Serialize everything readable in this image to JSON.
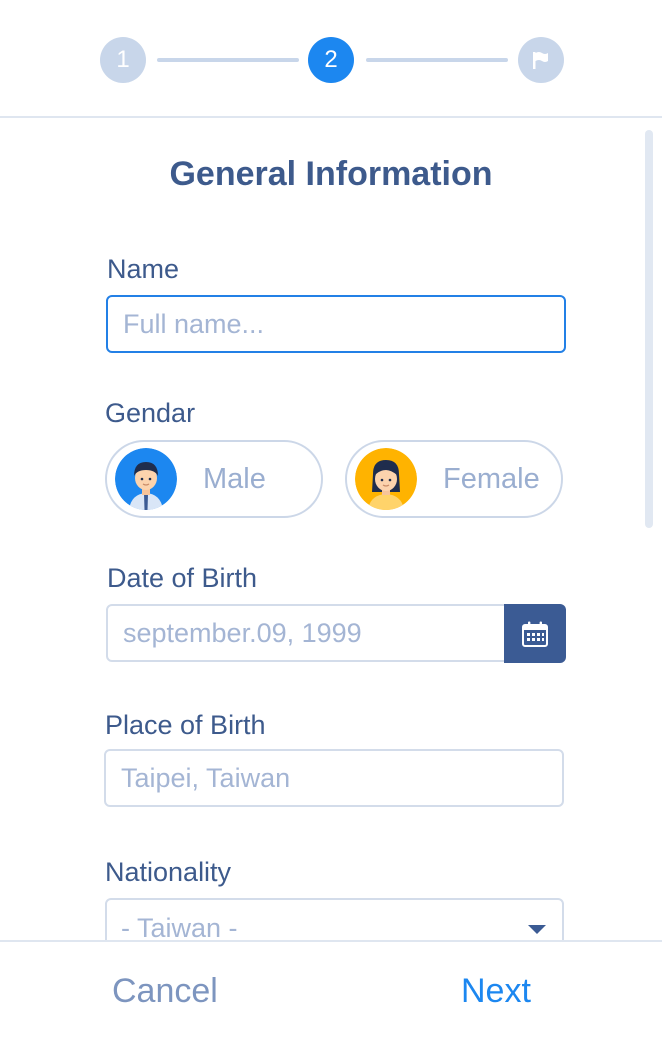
{
  "stepper": {
    "step1": "1",
    "step2": "2",
    "step3_icon": "flag-icon"
  },
  "form": {
    "title": "General Information",
    "name": {
      "label": "Name",
      "placeholder": "Full name..."
    },
    "gender": {
      "label": "Gendar",
      "options": [
        {
          "label": "Male",
          "icon": "male-avatar-icon"
        },
        {
          "label": "Female",
          "icon": "female-avatar-icon"
        }
      ]
    },
    "dob": {
      "label": "Date of Birth",
      "value": "september.09, 1999",
      "icon": "calendar-icon"
    },
    "pob": {
      "label": "Place of Birth",
      "value": "Taipei, Taiwan"
    },
    "nationality": {
      "label": "Nationality",
      "value": "- Taiwan -",
      "icon": "chevron-down-icon"
    }
  },
  "footer": {
    "cancel": "Cancel",
    "next": "Next"
  },
  "colors": {
    "accent": "#1c87f0",
    "text": "#3d5a8c",
    "muted": "#a4b5d4",
    "step_inactive": "#c8d6ea",
    "calendar_bg": "#3b5b94",
    "female_avatar_bg": "#ffb300"
  }
}
